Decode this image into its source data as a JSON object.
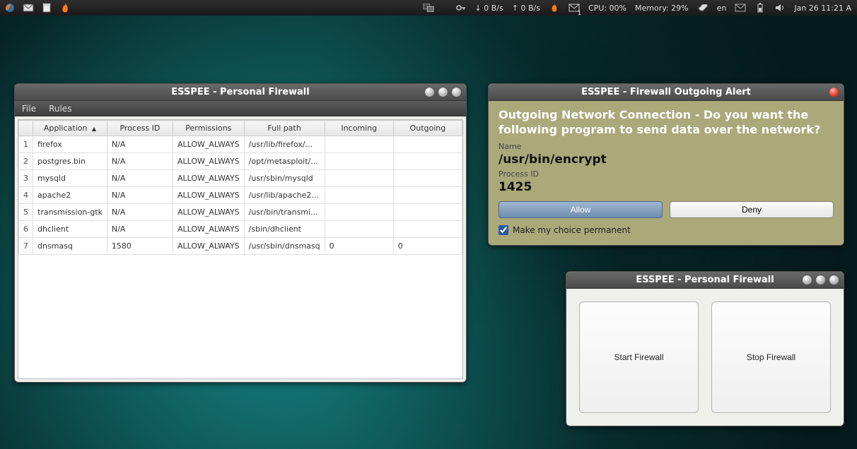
{
  "panel": {
    "net_down": "0 B/s",
    "net_up": "0 B/s",
    "mail_badge": "1",
    "cpu": "CPU: 00%",
    "memory": "Memory: 29%",
    "lang": "en",
    "clock": "Jan 26 11:21 A"
  },
  "fw_table": {
    "title": "ESSPEE - Personal Firewall",
    "menus": {
      "file": "File",
      "rules": "Rules"
    },
    "columns": {
      "app": "Application",
      "pid": "Process ID",
      "perms": "Permissions",
      "path": "Full path",
      "in": "Incoming",
      "out": "Outgoing"
    },
    "sort_indicator": "▲",
    "rows": [
      {
        "n": "1",
        "app": "firefox",
        "pid": "N/A",
        "perms": "ALLOW_ALWAYS",
        "path": "/usr/lib/firefox/...",
        "in": "",
        "out": ""
      },
      {
        "n": "2",
        "app": "postgres.bin",
        "pid": "N/A",
        "perms": "ALLOW_ALWAYS",
        "path": "/opt/metasploit/...",
        "in": "",
        "out": ""
      },
      {
        "n": "3",
        "app": "mysqld",
        "pid": "N/A",
        "perms": "ALLOW_ALWAYS",
        "path": "/usr/sbin/mysqld",
        "in": "",
        "out": ""
      },
      {
        "n": "4",
        "app": "apache2",
        "pid": "N/A",
        "perms": "ALLOW_ALWAYS",
        "path": "/usr/lib/apache2...",
        "in": "",
        "out": ""
      },
      {
        "n": "5",
        "app": "transmission-gtk",
        "pid": "N/A",
        "perms": "ALLOW_ALWAYS",
        "path": "/usr/bin/transmi...",
        "in": "",
        "out": ""
      },
      {
        "n": "6",
        "app": "dhclient",
        "pid": "N/A",
        "perms": "ALLOW_ALWAYS",
        "path": "/sbin/dhclient",
        "in": "",
        "out": ""
      },
      {
        "n": "7",
        "app": "dnsmasq",
        "pid": "1580",
        "perms": "ALLOW_ALWAYS",
        "path": "/usr/sbin/dnsmasq",
        "in": "0",
        "out": "0"
      }
    ]
  },
  "alert": {
    "title": "ESSPEE - Firewall Outgoing Alert",
    "heading": "Outgoing Network Connection - Do you want the following program to send data over the network?",
    "name_label": "Name",
    "name": "/usr/bin/encrypt",
    "pid_label": "Process ID",
    "pid": "1425",
    "allow": "Allow",
    "deny": "Deny",
    "perm_choice": "Make my choice permanent"
  },
  "ctl": {
    "title": "ESSPEE - Personal Firewall",
    "start": "Start Firewall",
    "stop": "Stop Firewall"
  }
}
